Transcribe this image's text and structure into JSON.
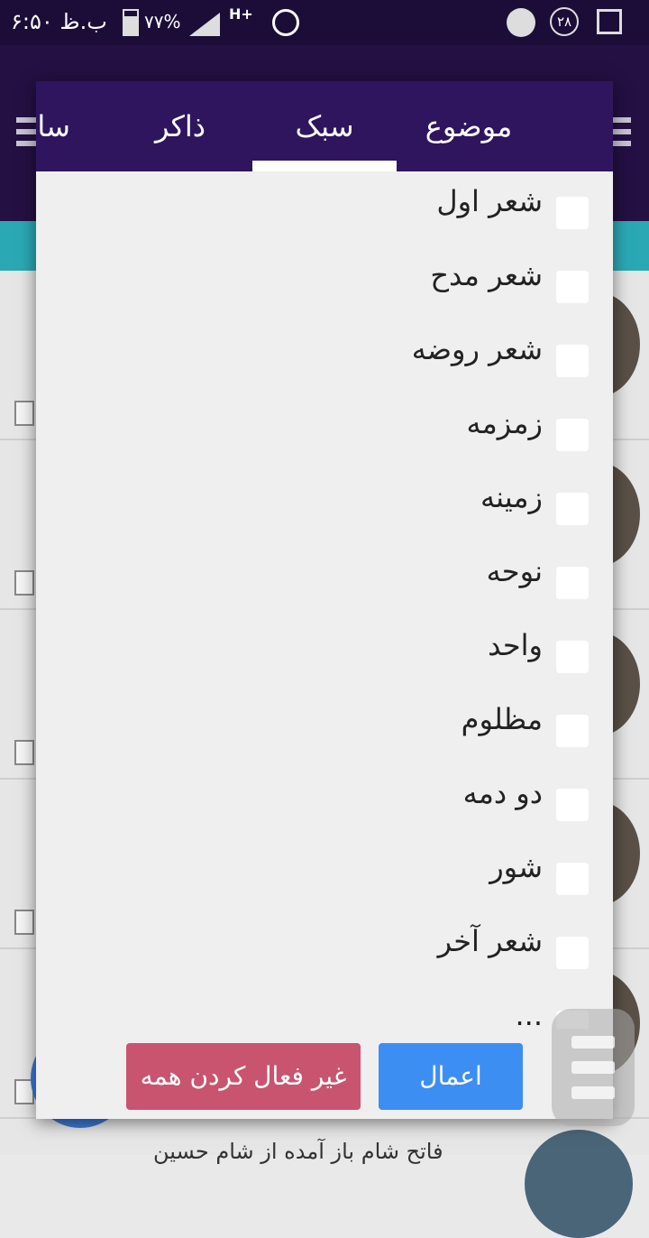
{
  "statusbar": {
    "time": "۶:۵۰ ب.ظ",
    "battery": "۷۷%",
    "network": "H+",
    "notification_count": "۲۸"
  },
  "background": {
    "bottom_item_text": "فاتح شام باز آمده از شام حسین"
  },
  "dialog": {
    "tabs": [
      "موضوع",
      "سبک",
      "ذاکر",
      "سال"
    ],
    "active_tab": "سبک",
    "options": [
      "شعر اول",
      "شعر مدح",
      "شعر روضه",
      "زمزمه",
      "زمینه",
      "نوحه",
      "واحد",
      "مظلوم",
      "دو دمه",
      "شور",
      "شعر آخر",
      "..."
    ],
    "apply_label": "اعمال",
    "clear_all_label": "غیر فعال کردن همه"
  },
  "colors": {
    "tab_bar": "#2f155e",
    "apply_button": "#3d8ef2",
    "clear_button": "#c95470",
    "app_bar": "#241043",
    "teal_bar": "#2aa9b5"
  }
}
